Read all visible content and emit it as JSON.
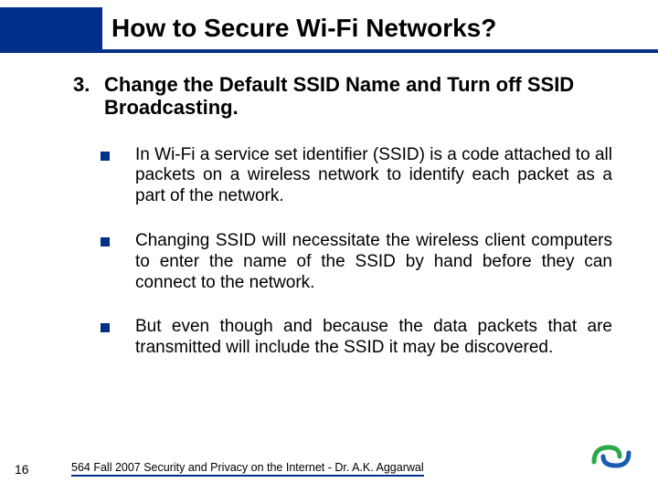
{
  "header": {
    "title": "How to Secure Wi-Fi Networks?"
  },
  "subtitle": {
    "number": "3.",
    "text": "Change the Default SSID Name and Turn off SSID Broadcasting."
  },
  "bullets": [
    "In Wi-Fi a service set identifier (SSID) is a code attached to all packets on a wireless network to identify each packet as a part of the network.",
    "Changing SSID will necessitate the wireless client computers to enter the name of the SSID by hand before they can connect to the network.",
    "But even though and because the data packets that are transmitted    will include the SSID it may be discovered."
  ],
  "footer": {
    "page": "16",
    "text": "564 Fall 2007 Security and Privacy on the Internet - Dr. A.K. Aggarwal"
  }
}
